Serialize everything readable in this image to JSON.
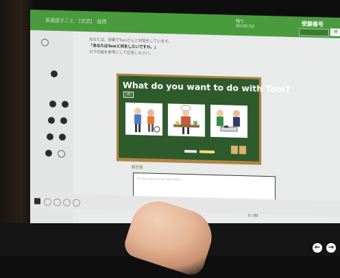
{
  "header": {
    "crumb": "英語話すこと　[交流]　設問",
    "clock_line1": "残り",
    "clock_line2": "00:05:52",
    "exam_number_label": "受験番号",
    "end_button": "終了"
  },
  "instructions": {
    "line1": "あなたは、授業でTomさんと対話をしています。",
    "line2_bold": "「あなたはTomと何をしたいですか。」",
    "line3": "以下の絵を参考にして応答しなさい。"
  },
  "board": {
    "question": "What do you want to do with Tom?",
    "example_tag": "[例]"
  },
  "answer": {
    "label": "解答欄",
    "placeholder": "(If you want to do with Tom) ...",
    "char_count": "0 / 80"
  },
  "nav": {
    "prev": "←",
    "next": "→"
  }
}
